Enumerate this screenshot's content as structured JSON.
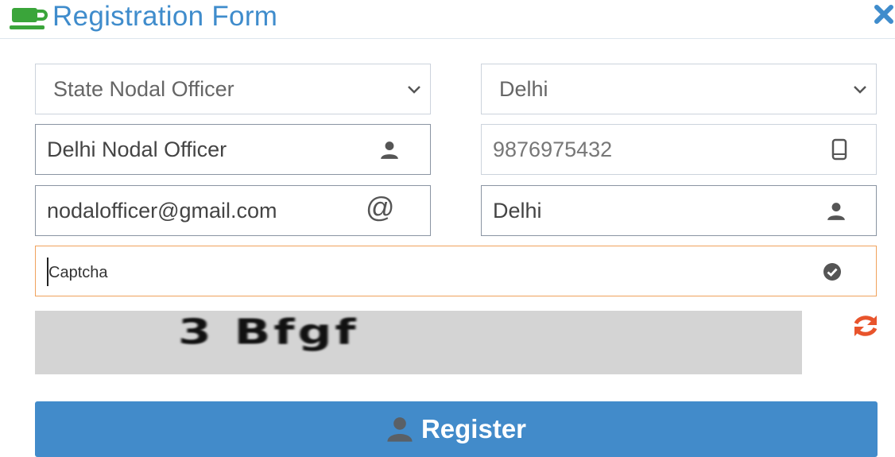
{
  "header": {
    "title": "Registration Form",
    "logo_icon": "coffee-cup-icon",
    "close_icon": "close-icon",
    "accent_color": "#3f8ccc"
  },
  "form": {
    "role_select": {
      "value": "State Nodal Officer",
      "icon": "chevron-down-icon"
    },
    "state_select": {
      "value": "Delhi",
      "icon": "chevron-down-icon"
    },
    "name_field": {
      "value": "Delhi Nodal Officer",
      "icon": "user-icon"
    },
    "mobile_field": {
      "value": "9876975432",
      "icon": "mobile-icon"
    },
    "email_field": {
      "value": "nodalofficer@gmail.com",
      "icon": "at-sign-icon",
      "icon_glyph": "@"
    },
    "district_field": {
      "value": "Delhi",
      "icon": "user-icon"
    },
    "captcha_field": {
      "placeholder": "Captcha",
      "icon": "check-circle-icon",
      "border_color": "#f0a25c"
    },
    "captcha_image": {
      "text": "3 Bfgf"
    },
    "refresh_icon": "refresh-icon",
    "refresh_color": "#e8542c"
  },
  "register_button": {
    "label": "Register",
    "icon": "user-icon",
    "color": "#428bca"
  }
}
